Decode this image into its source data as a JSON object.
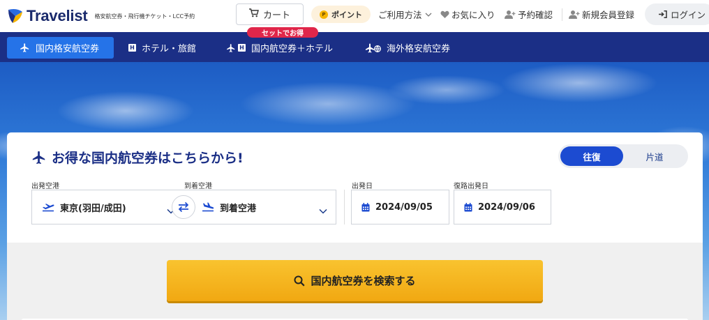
{
  "header": {
    "logo_text": "Travelist",
    "tagline": "格安航空券・飛行機チケット・LCC予約",
    "cart_label": "カート",
    "point_label": "ポイント",
    "point_coin": "P",
    "nav": {
      "guide": "ご利用方法",
      "favorites": "お気に入り",
      "reservation": "予約確認",
      "register": "新規会員登録",
      "login": "ログイン"
    }
  },
  "tabs": [
    {
      "label": "国内格安航空券"
    },
    {
      "label": "ホテル・旅館"
    },
    {
      "label": "国内航空券＋ホテル"
    },
    {
      "label": "海外格安航空券"
    }
  ],
  "promo_badge": "セットでお得",
  "search": {
    "title": "お得な国内航空券はこちらから!",
    "trip_options": [
      "往復",
      "片道"
    ],
    "departure_airport": {
      "label": "出発空港",
      "value": "東京(羽田/成田)"
    },
    "arrival_airport": {
      "label": "到着空港",
      "value": "到着空港"
    },
    "departure_date": {
      "label": "出発日",
      "value": "2024/09/05"
    },
    "return_date": {
      "label": "復路出発日",
      "value": "2024/09/06"
    },
    "submit_label": "国内航空券を検索する"
  },
  "colors": {
    "brand_navy": "#1b2f86",
    "active_tab": "#2573e8",
    "toggle_active": "#1c4bd1",
    "search_button": "#f5b51e",
    "promo": "#e0264a"
  },
  "icons": {
    "logo": "travelist-logo-icon",
    "cart": "cart-icon",
    "heart": "heart-icon",
    "user": "user-plus-icon",
    "login": "login-arrow-icon",
    "plane": "airplane-icon",
    "hotel": "hotel-h-icon",
    "globe": "globe-plane-icon",
    "calendar": "calendar-icon",
    "swap": "swap-arrows-icon",
    "search": "search-icon",
    "chevron": "chevron-down-icon"
  }
}
